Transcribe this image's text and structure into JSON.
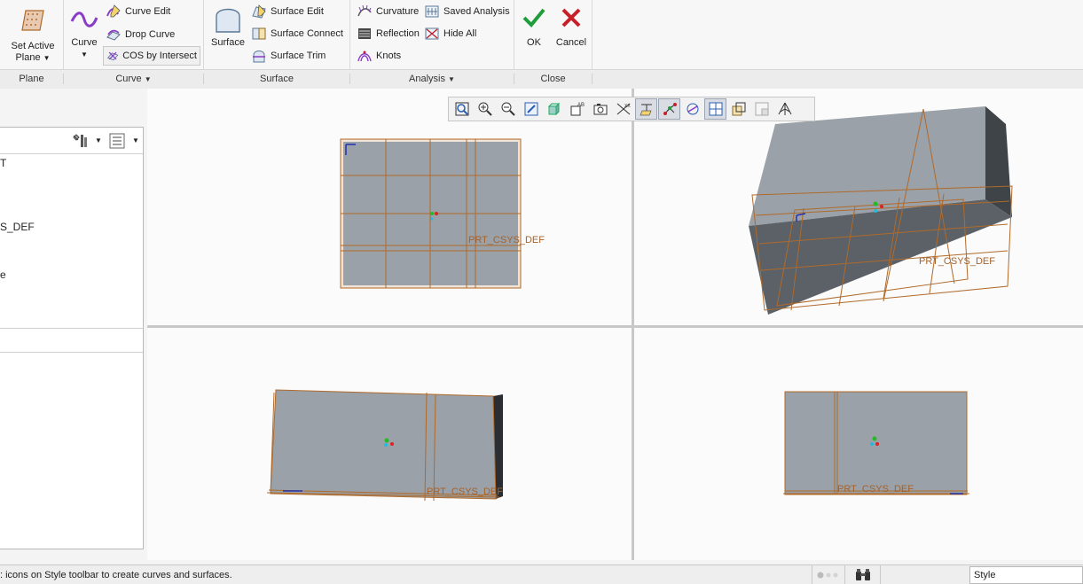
{
  "ribbon": {
    "plane": {
      "set_active_label_1": "Set Active",
      "set_active_label_2": "Plane",
      "group_label": "Plane"
    },
    "curve": {
      "curve_label": "Curve",
      "curve_edit": "Curve Edit",
      "drop_curve": "Drop Curve",
      "cos_by_intersect": "COS by Intersect",
      "group_label": "Curve"
    },
    "surface": {
      "surface_label": "Surface",
      "surface_edit": "Surface Edit",
      "surface_connect": "Surface Connect",
      "surface_trim": "Surface Trim",
      "group_label": "Surface"
    },
    "analysis": {
      "curvature": "Curvature",
      "reflection": "Reflection",
      "knots": "Knots",
      "saved_analysis": "Saved Analysis",
      "hide_all": "Hide All",
      "group_label": "Analysis"
    },
    "close": {
      "ok": "OK",
      "cancel": "Cancel",
      "group_label": "Close"
    }
  },
  "model_tree": {
    "items": [
      "T",
      "S_DEF",
      "e"
    ]
  },
  "viewports": {
    "csys_label": "PRT_CSYS_DEF"
  },
  "status": {
    "message": ": icons on Style toolbar to create curves and surfaces.",
    "mode": "Style"
  },
  "colors": {
    "edge": "#b06a2a",
    "face": "#9aa1a8",
    "ok_green": "#1e9e3a",
    "cancel_red": "#c8202a"
  }
}
